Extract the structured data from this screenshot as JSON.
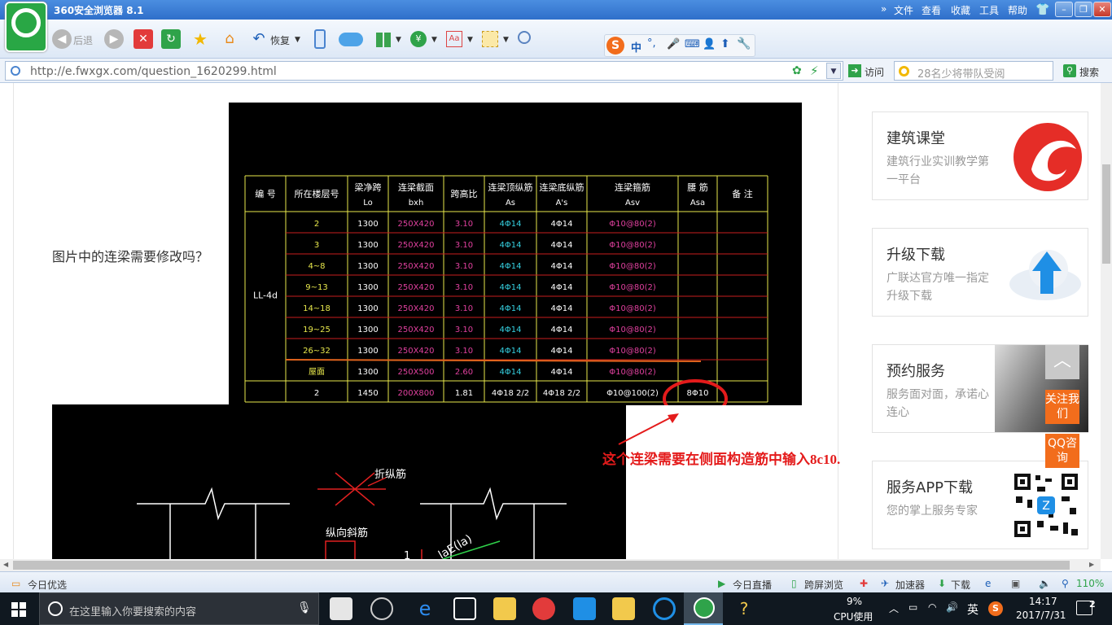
{
  "browser": {
    "title": "360安全浏览器 8.1",
    "menu": [
      "文件",
      "查看",
      "收藏",
      "工具",
      "帮助"
    ],
    "back_label": "后退",
    "restore_label": "恢复",
    "url_host": "http://e.fwxgx.com",
    "url_path": "/question_1620299.html",
    "visit_label": "访问",
    "search_placeholder": "28名少将带队受阅",
    "search_label": "搜索",
    "sogou_text": "中"
  },
  "page": {
    "question": "图片中的连梁需要修改吗？",
    "annotation": "这个连梁需要在侧面构造筋中输入8c10.",
    "cad_table": {
      "headers": [
        {
          "main": "编 号",
          "sub": ""
        },
        {
          "main": "所在楼层号",
          "sub": ""
        },
        {
          "main": "梁净跨",
          "sub": "Lo"
        },
        {
          "main": "连梁截面",
          "sub": "bxh"
        },
        {
          "main": "跨高比",
          "sub": ""
        },
        {
          "main": "连梁顶纵筋",
          "sub": "As"
        },
        {
          "main": "连梁底纵筋",
          "sub": "A's"
        },
        {
          "main": "连梁箍筋",
          "sub": "Asv"
        },
        {
          "main": "腰 筋",
          "sub": "Asa"
        },
        {
          "main": "备 注",
          "sub": ""
        }
      ],
      "group_label": "LL-4d",
      "rows": [
        [
          "2",
          "1300",
          "250X420",
          "3.10",
          "4Φ14",
          "4Φ14",
          "Φ10@80(2)",
          ""
        ],
        [
          "3",
          "1300",
          "250X420",
          "3.10",
          "4Φ14",
          "4Φ14",
          "Φ10@80(2)",
          ""
        ],
        [
          "4~8",
          "1300",
          "250X420",
          "3.10",
          "4Φ14",
          "4Φ14",
          "Φ10@80(2)",
          ""
        ],
        [
          "9~13",
          "1300",
          "250X420",
          "3.10",
          "4Φ14",
          "4Φ14",
          "Φ10@80(2)",
          ""
        ],
        [
          "14~18",
          "1300",
          "250X420",
          "3.10",
          "4Φ14",
          "4Φ14",
          "Φ10@80(2)",
          ""
        ],
        [
          "19~25",
          "1300",
          "250X420",
          "3.10",
          "4Φ14",
          "4Φ14",
          "Φ10@80(2)",
          ""
        ],
        [
          "26~32",
          "1300",
          "250X420",
          "3.10",
          "4Φ14",
          "4Φ14",
          "Φ10@80(2)",
          ""
        ],
        [
          "屋面",
          "1300",
          "250X500",
          "2.60",
          "4Φ14",
          "4Φ14",
          "Φ10@80(2)",
          ""
        ],
        [
          "2",
          "1450",
          "200X800",
          "1.81",
          "4Φ18 2/2",
          "4Φ18 2/2",
          "Φ10@100(2)",
          "8Φ10"
        ]
      ]
    },
    "cad_detail": {
      "label1": "折纵筋",
      "label2": "纵向斜筋",
      "label3": "laE(la)",
      "label4": "1"
    }
  },
  "sidebar": {
    "cards": [
      {
        "title": "建筑课堂",
        "desc": "建筑行业实训教学第一平台"
      },
      {
        "title": "升级下载",
        "desc": "广联达官方唯一指定升级下载"
      },
      {
        "title": "预约服务",
        "desc": "服务面对面，承诺心连心"
      },
      {
        "title": "服务APP下载",
        "desc": "您的掌上服务专家"
      }
    ],
    "float_follow": "关注我们",
    "float_qq": "QQ咨询"
  },
  "statusbar": {
    "left": "今日优选",
    "live": "今日直播",
    "crossscreen": "跨屏浏览",
    "accelerator": "加速器",
    "download": "下载",
    "zoom": "110%"
  },
  "taskbar": {
    "search_placeholder": "在这里输入你要搜索的内容",
    "cpu_percent": "9%",
    "cpu_label": "CPU使用",
    "ime": "英",
    "time": "14:17",
    "date": "2017/7/31",
    "notifications": "2"
  },
  "colors": {
    "cad_background": "#000000",
    "cad_grid": "#e8e84c",
    "cad_line": "#c81e1e",
    "annotation": "#e41b1b",
    "accent_orange": "#f26d1c"
  }
}
